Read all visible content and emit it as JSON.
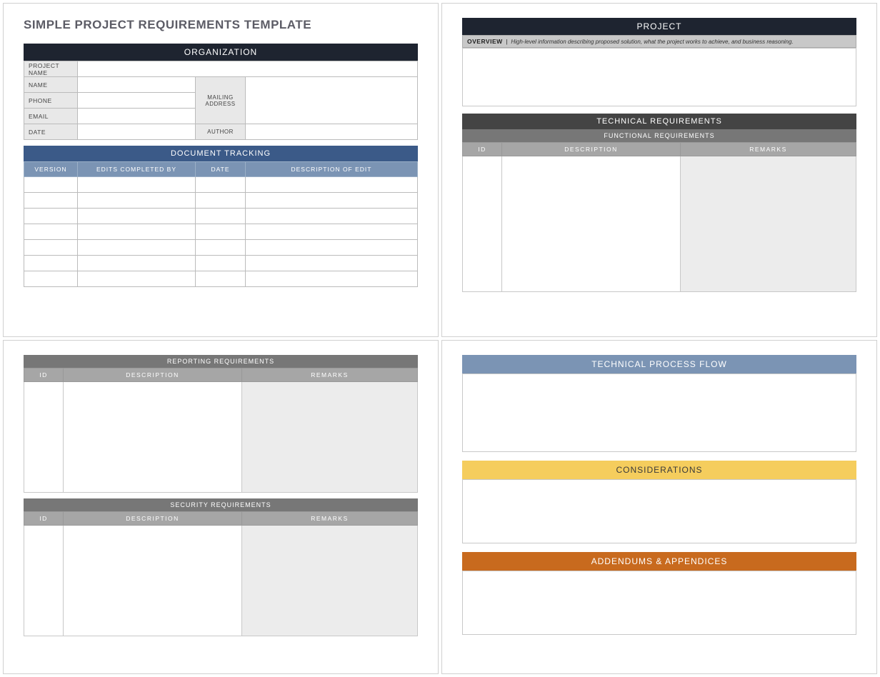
{
  "page1": {
    "title": "SIMPLE PROJECT REQUIREMENTS TEMPLATE",
    "org_header": "ORGANIZATION",
    "fields": {
      "project_name": "PROJECT NAME",
      "name": "NAME",
      "phone": "PHONE",
      "email": "EMAIL",
      "date": "DATE",
      "mailing_address": "MAILING ADDRESS",
      "author": "AUTHOR"
    },
    "tracking_header": "DOCUMENT TRACKING",
    "tracking_cols": {
      "version": "VERSION",
      "edits_by": "EDITS COMPLETED BY",
      "date": "DATE",
      "desc": "DESCRIPTION OF EDIT"
    },
    "tracking_rows": 7
  },
  "page2": {
    "project_header": "PROJECT",
    "overview_label": "OVERVIEW",
    "overview_desc": "High-level information describing proposed solution, what the project works to achieve, and business reasoning.",
    "tech_header": "TECHNICAL REQUIREMENTS",
    "func_header": "FUNCTIONAL REQUIREMENTS",
    "cols": {
      "id": "ID",
      "desc": "DESCRIPTION",
      "remarks": "REMARKS"
    }
  },
  "page3": {
    "reporting_header": "REPORTING REQUIREMENTS",
    "security_header": "SECURITY REQUIREMENTS",
    "cols": {
      "id": "ID",
      "desc": "DESCRIPTION",
      "remarks": "REMARKS"
    }
  },
  "page4": {
    "flow_header": "TECHNICAL PROCESS FLOW",
    "considerations_header": "CONSIDERATIONS",
    "addendums_header": "ADDENDUMS & APPENDICES"
  }
}
